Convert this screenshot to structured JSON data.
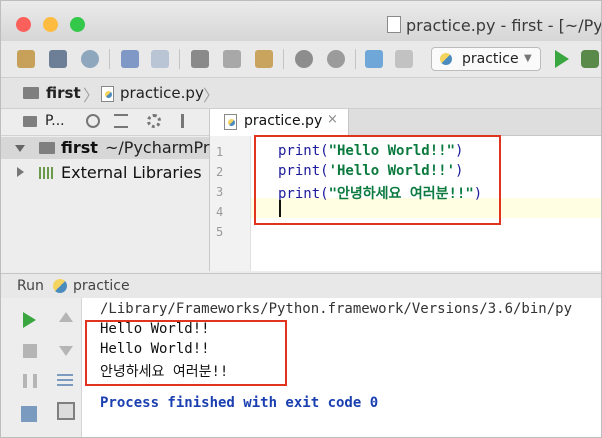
{
  "window": {
    "title": "practice.py - first - [~/Pyc"
  },
  "toolbar": {
    "run_config": "practice"
  },
  "navbar": {
    "project": "first",
    "file": "practice.py"
  },
  "project_panel": {
    "view_label": "P...",
    "tree": {
      "root_name": "first",
      "root_path": "~/PycharmPro",
      "external": "External Libraries"
    }
  },
  "editor": {
    "tab_label": "practice.py",
    "tab_close": "×",
    "line_numbers": [
      "1",
      "2",
      "3",
      "4",
      "5"
    ],
    "lines": [
      {
        "fn": "print(",
        "str": "\"Hello World!!\"",
        "end": ")"
      },
      {
        "fn": "print(",
        "str": "'Hello World!!'",
        "end": ")"
      },
      {
        "fn": "print(",
        "str": "\"안녕하세요 여러분!!\"",
        "end": ")"
      }
    ]
  },
  "run_panel": {
    "title": "Run",
    "config_name": "practice",
    "console": {
      "path_line": "/Library/Frameworks/Python.framework/Versions/3.6/bin/py",
      "output": [
        "Hello World!!",
        "Hello World!!",
        "안녕하세요 여러분!!"
      ],
      "exit_line": "Process finished with exit code 0"
    }
  },
  "colors": {
    "highlight_box": "#e0341f",
    "run_green": "#3aa640",
    "string_green": "#0b7a3e"
  }
}
